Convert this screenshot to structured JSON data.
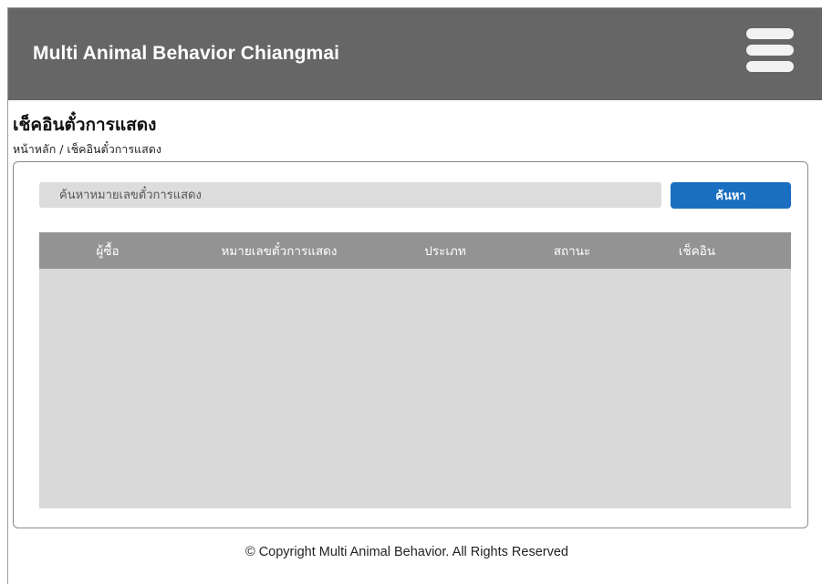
{
  "header": {
    "brand": "Multi Animal Behavior Chiangmai",
    "menu_icon": "hamburger-menu-icon",
    "background_color": "#666666"
  },
  "page": {
    "title": "เช็คอินตั๋วการแสดง",
    "breadcrumb": "หน้าหลัก / เช็คอินตั๋วการแสดง"
  },
  "search": {
    "placeholder": "ค้นหาหมายเลขตั๋วการแสดง",
    "value": "",
    "button_label": "ค้นหา",
    "button_color": "#1a6fc0"
  },
  "table": {
    "columns": [
      "ผู้ซื้อ",
      "หมายเลขตั๋วการแสดง",
      "ประเภท",
      "สถานะ",
      "เช็คอิน"
    ],
    "rows": []
  },
  "footer": {
    "copyright": "© Copyright Multi Animal Behavior. All Rights Reserved"
  }
}
